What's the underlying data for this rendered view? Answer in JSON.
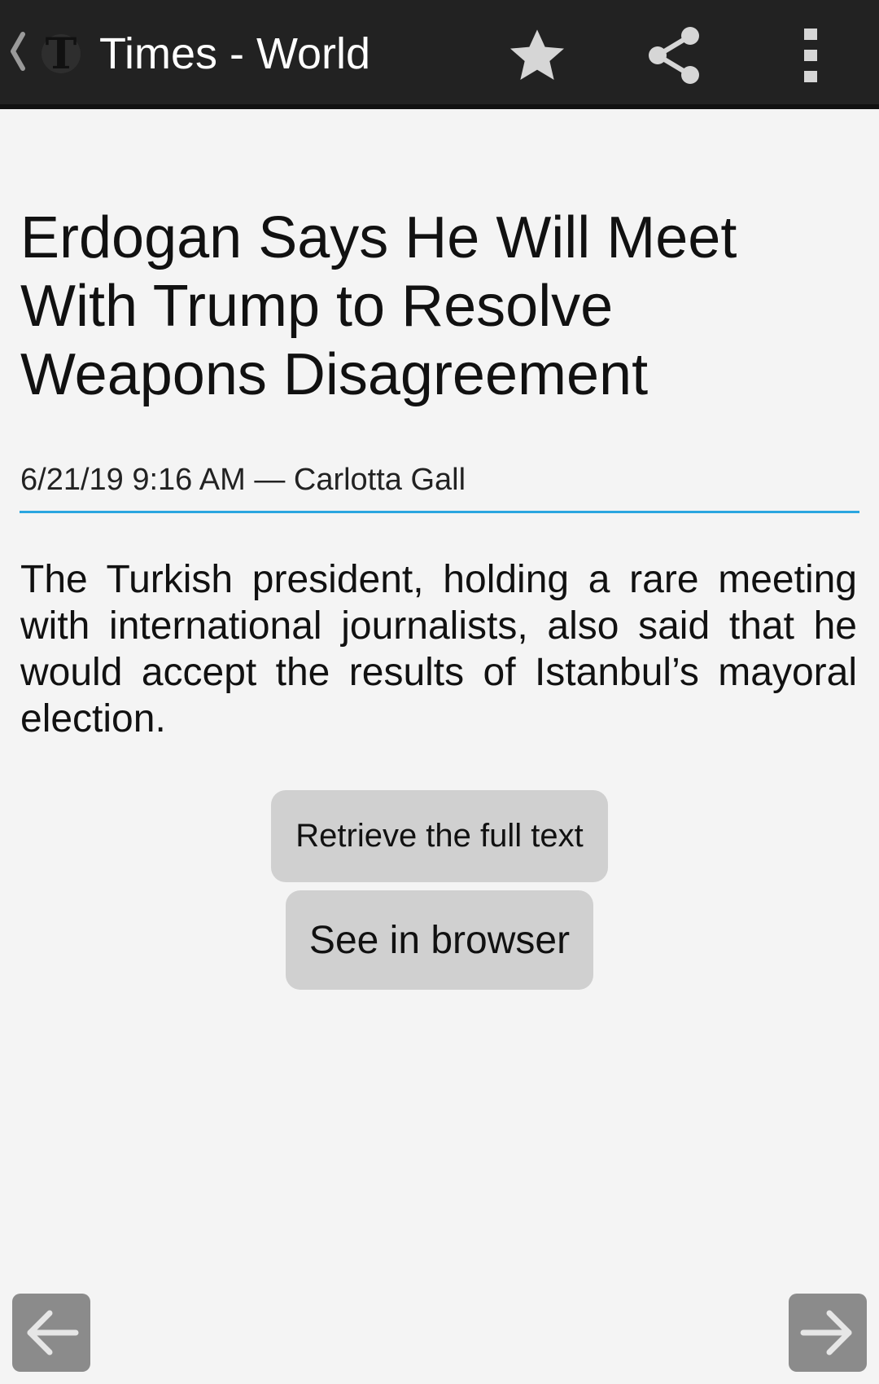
{
  "toolbar": {
    "title": "Times - World",
    "logo_letter": "T",
    "icons": [
      "back-chevron-icon",
      "times-logo-icon",
      "star-icon",
      "share-icon",
      "more-vert-icon"
    ]
  },
  "article": {
    "title": "Erdogan Says He Will Meet With Trump to Resolve Weapons Disagreement",
    "byline": "6/21/19 9:16 AM — Carlotta Gall",
    "summary": "The Turkish president, holding a rare meeting with international journalists, also said that he would accept the results of Istanbul’s mayoral election."
  },
  "actions": {
    "retrieve_label": "Retrieve the full text",
    "browser_label": "See in browser"
  },
  "navigation": {
    "prev_icon": "arrow-left-icon",
    "next_icon": "arrow-right-icon"
  },
  "colors": {
    "toolbar_bg": "#222222",
    "page_bg": "#f4f4f4",
    "accent_divider": "#2aa6e0",
    "button_bg": "#d0d0d0",
    "nav_button_bg": "#8b8b8b"
  }
}
